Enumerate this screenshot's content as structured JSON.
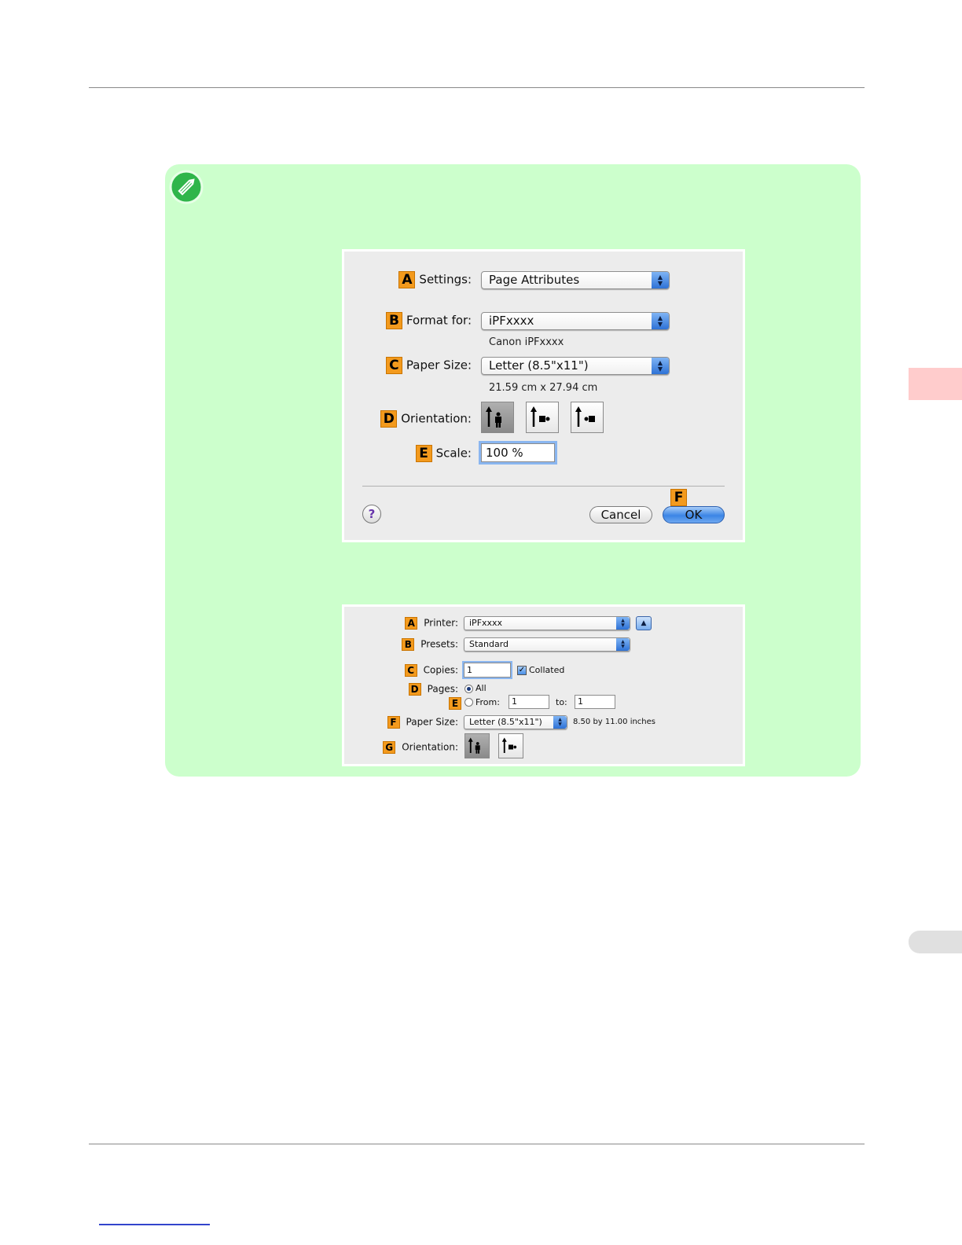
{
  "dialog1": {
    "settings": {
      "badge": "A",
      "label": "Settings:",
      "value": "Page Attributes"
    },
    "format_for": {
      "badge": "B",
      "label": "Format for:",
      "value": "iPFxxxx",
      "sub": "Canon iPFxxxx"
    },
    "paper_size": {
      "badge": "C",
      "label": "Paper Size:",
      "value": "Letter (8.5\"x11\")",
      "sub": "21.59 cm x 27.94 cm"
    },
    "orientation": {
      "badge": "D",
      "label": "Orientation:",
      "selected": "portrait"
    },
    "scale": {
      "badge": "E",
      "label": "Scale:",
      "value": "100 %"
    },
    "help_label": "?",
    "cancel_label": "Cancel",
    "ok_badge": "F",
    "ok_label": "OK"
  },
  "dialog2": {
    "printer": {
      "badge": "A",
      "label": "Printer:",
      "value": "iPFxxxx",
      "expand_icon": "▲"
    },
    "presets": {
      "badge": "B",
      "label": "Presets:",
      "value": "Standard"
    },
    "copies": {
      "badge": "C",
      "label": "Copies:",
      "value": "1",
      "collated_label": "Collated",
      "collated": true
    },
    "pages": {
      "badge": "D",
      "label": "Pages:",
      "all_label": "All",
      "all_selected": true
    },
    "range": {
      "badge": "E",
      "from_label": "From:",
      "from_value": "1",
      "to_label": "to:",
      "to_value": "1"
    },
    "paper_size": {
      "badge": "F",
      "label": "Paper Size:",
      "value": "Letter (8.5\"x11\")",
      "dimensions": "8.50 by 11.00 inches"
    },
    "orientation": {
      "badge": "G",
      "label": "Orientation:",
      "selected": "portrait"
    }
  },
  "colors": {
    "note_bg": "#ccffcc",
    "badge": "#f39a1d",
    "side_tab": "#ffcccc",
    "side_tab_gray": "#e0e0e0"
  }
}
